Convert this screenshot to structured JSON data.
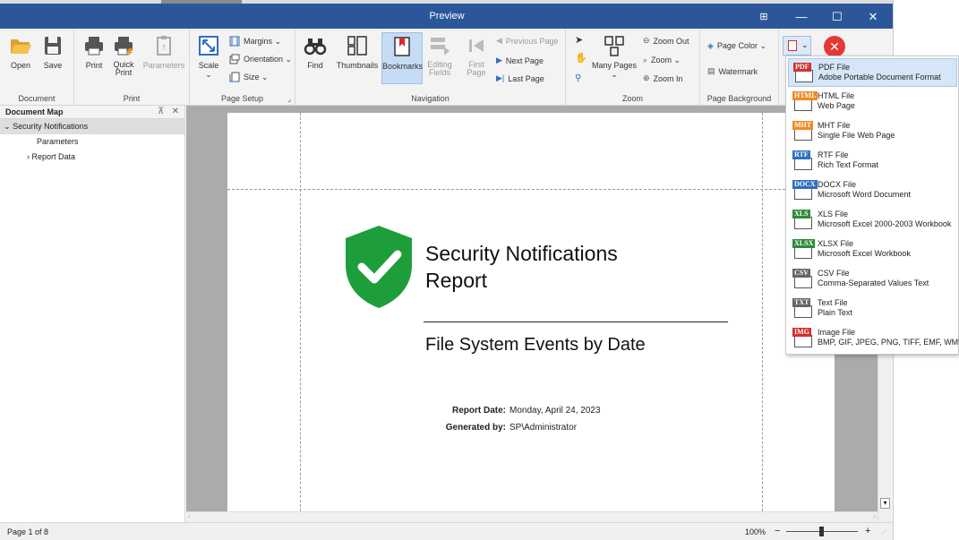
{
  "window": {
    "title": "Preview",
    "controls": {
      "ribbon_toggle": "⊞",
      "minimize": "—",
      "maximize": "☐",
      "close": "✕"
    }
  },
  "ribbon": {
    "groups": {
      "document": "Document",
      "print": "Print",
      "page_setup": "Page Setup",
      "navigation": "Navigation",
      "zoom": "Zoom",
      "page_background": "Page Background"
    },
    "buttons": {
      "open": "Open",
      "save": "Save",
      "print": "Print",
      "quick_print_1": "Quick",
      "quick_print_2": "Print",
      "parameters": "Parameters",
      "scale": "Scale",
      "margins": "Margins ⌄",
      "orientation": "Orientation ⌄",
      "size": "Size ⌄",
      "find": "Find",
      "thumbnails": "Thumbnails",
      "bookmarks": "Bookmarks",
      "editing_fields_1": "Editing",
      "editing_fields_2": "Fields",
      "first_page_1": "First",
      "first_page_2": "Page",
      "previous_page": "Previous Page",
      "next_page": "Next Page",
      "last_page": "Last Page",
      "many_pages": "Many Pages",
      "zoom_out": "Zoom Out",
      "zoom": "Zoom ⌄",
      "zoom_in": "Zoom In",
      "page_color": "Page Color ⌄",
      "watermark": "Watermark"
    }
  },
  "document_map": {
    "title": "Document Map",
    "pin": "⊼",
    "close": "✕",
    "items": [
      {
        "label": "Security Notifications",
        "prefix": "⌄"
      },
      {
        "label": "Parameters",
        "prefix": ""
      },
      {
        "label": "Report Data",
        "prefix": "›"
      }
    ]
  },
  "report": {
    "title_line1": "Security Notifications",
    "title_line2": "Report",
    "subtitle": "File System Events by Date",
    "date_label": "Report Date:",
    "date_value": "Monday, April 24, 2023",
    "generated_label": "Generated by:",
    "generated_value": "SP\\Administrator",
    "shield_color": "#1e9e3a"
  },
  "status": {
    "page": "Page 1 of 8",
    "zoom": "100%",
    "zoom_minus": "−",
    "zoom_plus": "+"
  },
  "export_menu": {
    "items": [
      {
        "badge": "PDF",
        "color": "#d32f2f",
        "title": "PDF File",
        "subtitle": "Adobe Portable Document Format"
      },
      {
        "badge": "HTML",
        "color": "#f08a24",
        "title": "HTML File",
        "subtitle": "Web Page"
      },
      {
        "badge": "MHT",
        "color": "#f08a24",
        "title": "MHT File",
        "subtitle": "Single File Web Page"
      },
      {
        "badge": "RTF",
        "color": "#2f6fc0",
        "title": "RTF File",
        "subtitle": "Rich Text Format"
      },
      {
        "badge": "DOCX",
        "color": "#2f6fc0",
        "title": "DOCX File",
        "subtitle": "Microsoft Word Document"
      },
      {
        "badge": "XLS",
        "color": "#2e8b3a",
        "title": "XLS File",
        "subtitle": "Microsoft Excel 2000-2003 Workbook"
      },
      {
        "badge": "XLSX",
        "color": "#2e8b3a",
        "title": "XLSX File",
        "subtitle": "Microsoft Excel Workbook"
      },
      {
        "badge": "CSV",
        "color": "#666666",
        "title": "CSV File",
        "subtitle": "Comma-Separated Values Text"
      },
      {
        "badge": "TXT",
        "color": "#666666",
        "title": "Text File",
        "subtitle": "Plain Text"
      },
      {
        "badge": "IMG",
        "color": "#d32f2f",
        "title": "Image File",
        "subtitle": "BMP, GIF, JPEG, PNG, TIFF, EMF, WMF"
      }
    ]
  },
  "colors": {
    "titlebar": "#2b579a",
    "accent": "#c5dcf4",
    "close_red": "#e53935"
  }
}
